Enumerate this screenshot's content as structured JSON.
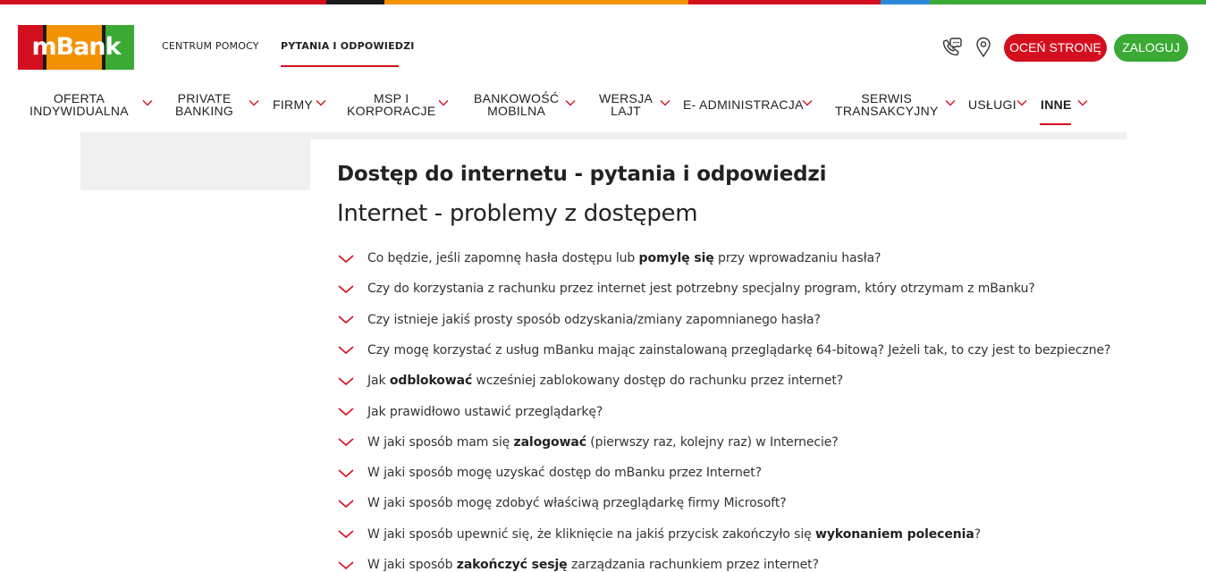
{
  "brand": {
    "logo_text": "mBank",
    "stripe_colors": [
      "#d40f1d",
      "#1a1a1a",
      "#f39200",
      "#d40f1d",
      "#2b8ad8",
      "#3aaa35"
    ],
    "logo_colors": [
      "#d40f1d",
      "#1a1a1a",
      "#f39200",
      "#1a1a1a",
      "#3aaa35"
    ],
    "accent": "#d40f1d",
    "green": "#3aaa35"
  },
  "header": {
    "links": [
      "CENTRUM POMOCY",
      "PYTANIA I ODPOWIEDZI"
    ],
    "icons": [
      "phone-chat-icon",
      "location-pin-icon"
    ],
    "rate_button": "OCEŃ STRONĘ",
    "login_button": "ZALOGUJ"
  },
  "nav": {
    "items": [
      {
        "label": "OFERTA\nINDYWIDUALNA"
      },
      {
        "label": "PRIVATE\nBANKING"
      },
      {
        "label": "FIRMY"
      },
      {
        "label": "MSP I\nKORPORACJE"
      },
      {
        "label": "BANKOWOŚĆ\nMOBILNA"
      },
      {
        "label": "WERSJA\nLAJT"
      },
      {
        "label": "E- ADMINISTRACJA"
      },
      {
        "label": "SERWIS\nTRANSAKCYJNY"
      },
      {
        "label": "USŁUGI"
      },
      {
        "label": "INNE"
      }
    ],
    "active": "INNE"
  },
  "content": {
    "title": "Dostęp do internetu - pytania i odpowiedzi",
    "subtitle": "Internet - problemy z dostępem",
    "faq": [
      {
        "before": "Co będzie, jeśli zapomnę hasła dostępu lub ",
        "bold": "pomylę się",
        "after": " przy wprowadzaniu hasła?"
      },
      {
        "before": "Czy do korzystania z rachunku przez internet jest potrzebny specjalny program, który otrzymam z mBanku?",
        "bold": "",
        "after": ""
      },
      {
        "before": "Czy istnieje jakiś prosty sposób odzyskania/zmiany zapomnianego hasła?",
        "bold": "",
        "after": ""
      },
      {
        "before": "Czy mogę korzystać z usług mBanku mając zainstalowaną przeglądarkę 64-bitową? Jeżeli tak, to czy jest to bezpieczne?",
        "bold": "",
        "after": ""
      },
      {
        "before": "Jak ",
        "bold": "odblokować",
        "after": " wcześniej zablokowany dostęp do rachunku przez internet?"
      },
      {
        "before": "Jak prawidłowo ustawić przeglądarkę?",
        "bold": "",
        "after": ""
      },
      {
        "before": "W jaki sposób mam się ",
        "bold": "zalogować",
        "after": " (pierwszy raz, kolejny raz) w Internecie?"
      },
      {
        "before": "W jaki sposób mogę uzyskać dostęp do mBanku przez Internet?",
        "bold": "",
        "after": ""
      },
      {
        "before": "W jaki sposób mogę zdobyć właściwą przeglądarkę firmy Microsoft?",
        "bold": "",
        "after": ""
      },
      {
        "before": "W jaki sposób upewnić się, że kliknięcie na jakiś przycisk zakończyło się ",
        "bold": "wykonaniem polecenia",
        "after": "?"
      },
      {
        "before": "W jaki sposób ",
        "bold": "zakończyć sesję",
        "after": " zarządzania rachunkiem przez internet?"
      }
    ]
  }
}
